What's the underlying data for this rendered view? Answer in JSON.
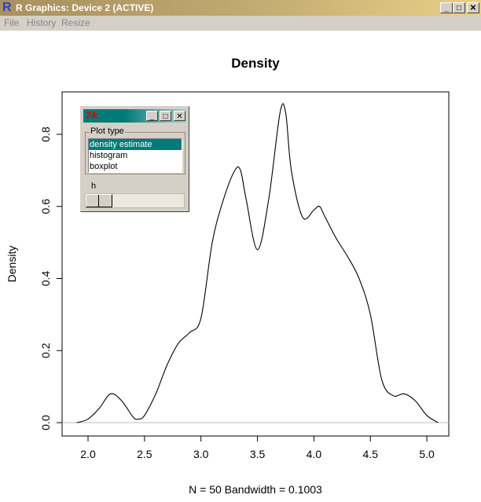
{
  "window": {
    "title": "R Graphics: Device 2 (ACTIVE)",
    "icon": "r-logo-icon",
    "buttons": [
      "minimize",
      "maximize",
      "close"
    ]
  },
  "menu": [
    "File",
    "History",
    "Resize"
  ],
  "tk_widget": {
    "logo": "tk-feather-icon",
    "group_label": "Plot type",
    "options": [
      "density estimate",
      "histogram",
      "boxplot"
    ],
    "selected": "density estimate",
    "slider_label": "h",
    "slider_value": 0
  },
  "chart_data": {
    "type": "line",
    "title": "Density",
    "xlabel": "N = 50   Bandwidth = 0.1003",
    "ylabel": "Density",
    "xlim": [
      1.78,
      5.2
    ],
    "ylim": [
      -0.035,
      0.905
    ],
    "xticks": [
      "2.0",
      "2.5",
      "3.0",
      "3.5",
      "4.0",
      "4.5",
      "5.0"
    ],
    "yticks": [
      "0.0",
      "0.2",
      "0.4",
      "0.6",
      "0.8"
    ],
    "baseline_color": "#bebebe",
    "x": [
      1.9,
      2.0,
      2.1,
      2.2,
      2.3,
      2.4,
      2.45,
      2.5,
      2.6,
      2.7,
      2.8,
      2.9,
      3.0,
      3.1,
      3.2,
      3.3,
      3.35,
      3.4,
      3.5,
      3.6,
      3.7,
      3.75,
      3.8,
      3.9,
      4.0,
      4.05,
      4.1,
      4.2,
      4.3,
      4.4,
      4.5,
      4.6,
      4.7,
      4.8,
      4.9,
      5.0,
      5.1
    ],
    "y": [
      0.0,
      0.01,
      0.04,
      0.08,
      0.06,
      0.015,
      0.01,
      0.02,
      0.08,
      0.16,
      0.22,
      0.25,
      0.29,
      0.5,
      0.62,
      0.7,
      0.7,
      0.62,
      0.48,
      0.62,
      0.86,
      0.86,
      0.7,
      0.57,
      0.59,
      0.6,
      0.57,
      0.51,
      0.46,
      0.4,
      0.3,
      0.12,
      0.075,
      0.08,
      0.06,
      0.02,
      0.0
    ]
  }
}
